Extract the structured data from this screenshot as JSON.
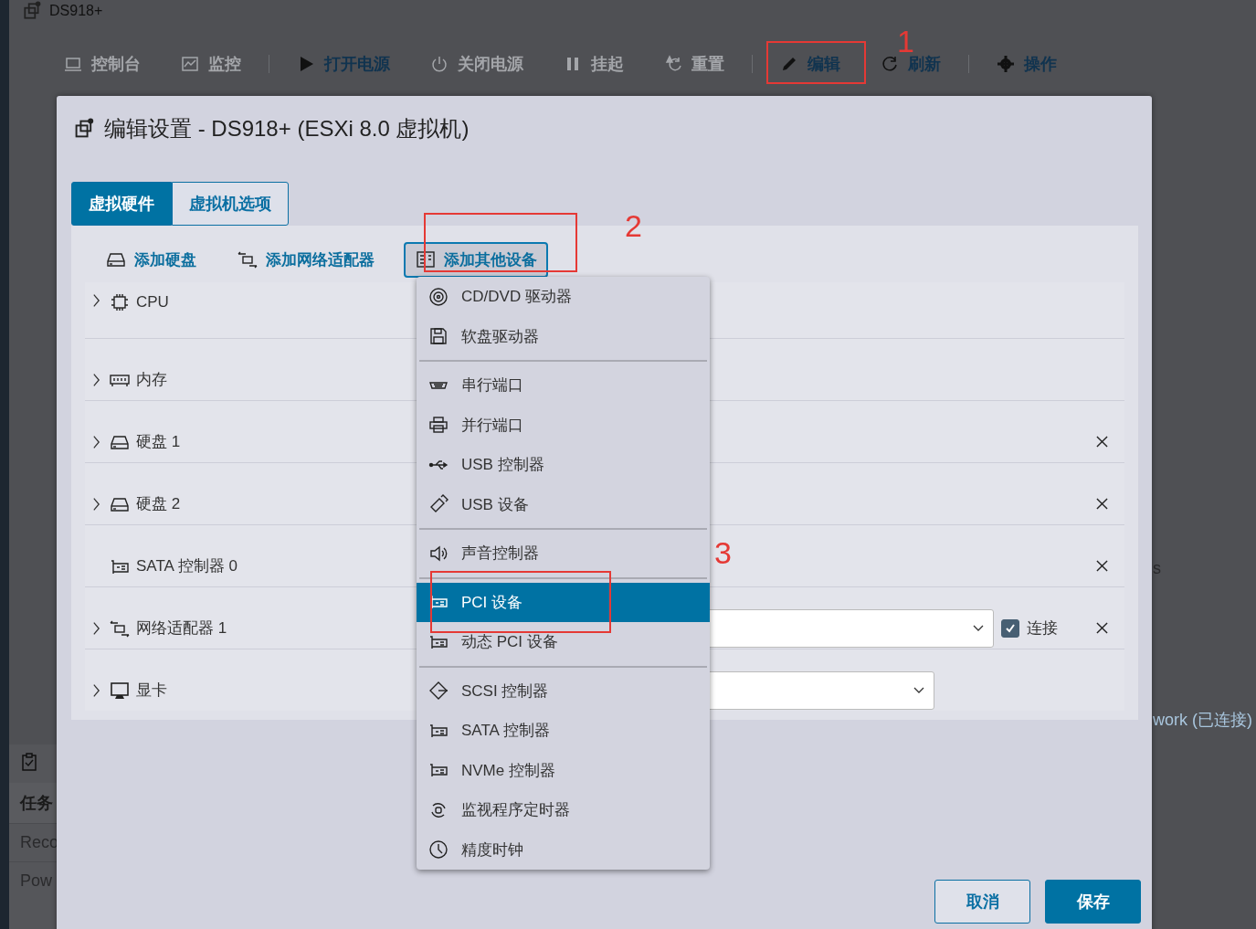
{
  "app": {
    "title": "DS918+"
  },
  "toolbar": [
    {
      "label": "控制台",
      "disabled": true
    },
    {
      "label": "监控",
      "disabled": true
    },
    {
      "label": "打开电源",
      "disabled": false
    },
    {
      "label": "关闭电源",
      "disabled": true
    },
    {
      "label": "挂起",
      "disabled": true
    },
    {
      "label": "重置",
      "disabled": true
    },
    {
      "label": "编辑",
      "disabled": false
    },
    {
      "label": "刷新",
      "disabled": false
    },
    {
      "label": "操作",
      "disabled": false
    }
  ],
  "background": {
    "tasks_header": "任务",
    "task_rows": [
      "Reco",
      "Pow"
    ],
    "right_texts": [
      "s",
      "work (已连接)"
    ]
  },
  "dialog": {
    "title": "编辑设置 - DS918+ (ESXi 8.0 虚拟机)",
    "tabs": [
      {
        "label": "虚拟硬件",
        "selected": true
      },
      {
        "label": "虚拟机选项",
        "selected": false
      }
    ],
    "add_buttons": [
      {
        "label": "添加硬盘",
        "selected": false
      },
      {
        "label": "添加网络适配器",
        "selected": false
      },
      {
        "label": "添加其他设备",
        "selected": true
      }
    ],
    "devices": [
      {
        "label": "CPU",
        "expandable": true,
        "removable": false
      },
      {
        "label": "内存",
        "expandable": true,
        "removable": false
      },
      {
        "label": "硬盘 1",
        "expandable": true,
        "removable": true
      },
      {
        "label": "硬盘 2",
        "expandable": true,
        "removable": true
      },
      {
        "label": "SATA 控制器 0",
        "expandable": false,
        "removable": true
      },
      {
        "label": "网络适配器 1",
        "expandable": true,
        "removable": true,
        "select": true,
        "connect": {
          "label": "连接",
          "checked": true
        }
      },
      {
        "label": "显卡",
        "expandable": true,
        "removable": false,
        "select": true
      }
    ],
    "buttons": [
      {
        "label": "取消",
        "kind": "secondary"
      },
      {
        "label": "保存",
        "kind": "primary"
      }
    ]
  },
  "menu": {
    "groups": [
      [
        {
          "label": "CD/DVD 驱动器",
          "selected": false
        },
        {
          "label": "软盘驱动器",
          "selected": false
        }
      ],
      [
        {
          "label": "串行端口",
          "selected": false
        },
        {
          "label": "并行端口",
          "selected": false
        },
        {
          "label": "USB 控制器",
          "selected": false
        },
        {
          "label": "USB 设备",
          "selected": false
        }
      ],
      [
        {
          "label": "声音控制器",
          "selected": false
        }
      ],
      [
        {
          "label": "PCI 设备",
          "selected": true
        },
        {
          "label": "动态 PCI 设备",
          "selected": false
        }
      ],
      [
        {
          "label": "SCSI 控制器",
          "selected": false
        },
        {
          "label": "SATA 控制器",
          "selected": false
        },
        {
          "label": "NVMe 控制器",
          "selected": false
        },
        {
          "label": "监视程序定时器",
          "selected": false
        },
        {
          "label": "精度时钟",
          "selected": false
        }
      ]
    ]
  },
  "annotations": [
    "1",
    "2",
    "3"
  ]
}
